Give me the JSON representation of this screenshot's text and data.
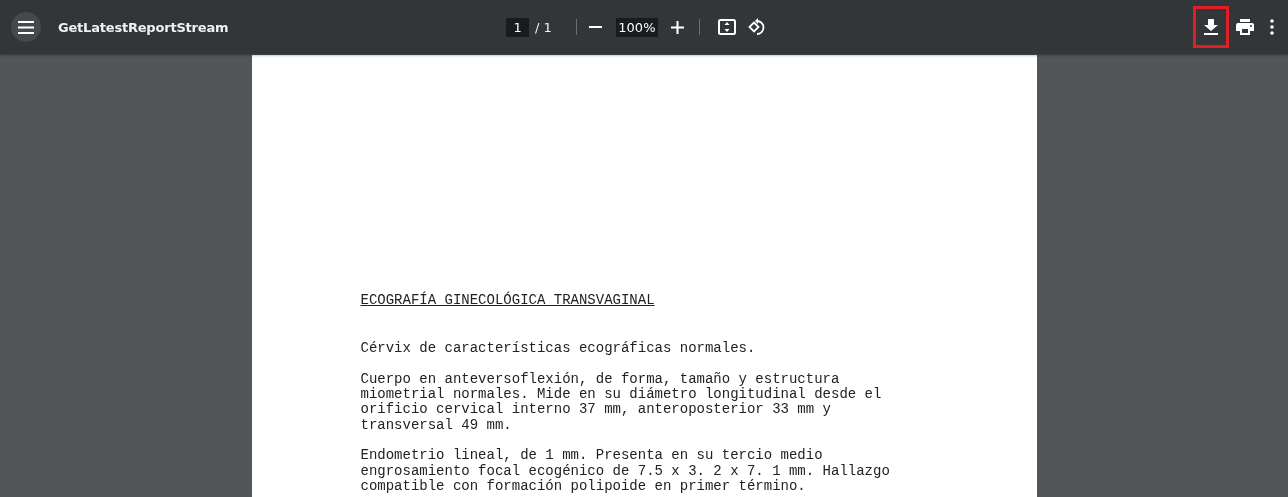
{
  "toolbar": {
    "title": "GetLatestReportStream",
    "page_number": "1",
    "page_count": "/ 1",
    "zoom": "100%",
    "download_highlighted": true
  },
  "document": {
    "heading": "ECOGRAFÍA GINECOLÓGICA TRANSVAGINAL",
    "paragraphs": [
      "Cérvix de características ecográficas normales.",
      "Cuerpo en anteversoflexión, de forma, tamaño y estructura\nmiometrial normales. Mide en su diámetro longitudinal desde el\norificio cervical interno 37 mm, anteroposterior 33 mm y\ntransversal 49 mm.",
      "Endometrio lineal, de 1 mm. Presenta en su tercio medio\nengrosamiento focal ecogénico de 7.5 x 3. 2 x 7. 1 mm. Hallazgo\ncompatible con formación polipoide en primer término."
    ]
  }
}
